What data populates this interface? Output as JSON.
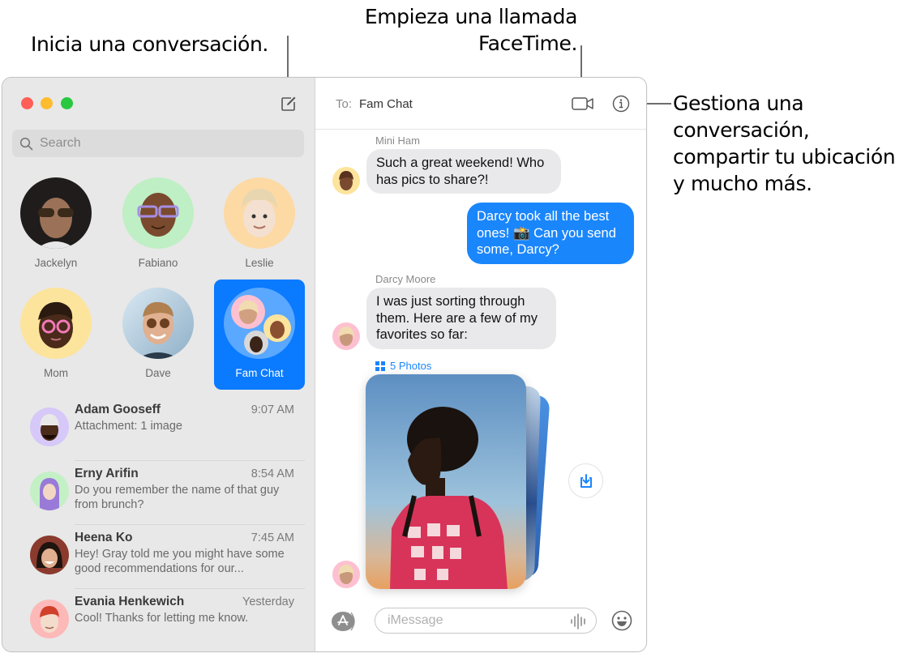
{
  "callouts": {
    "new_conversation": "Inicia una conversación.",
    "facetime_line1": "Empieza una llamada",
    "facetime_line2": "FaceTime.",
    "details_lines": [
      "Gestiona una",
      "conversación,",
      "compartir tu ubicación",
      "y mucho más."
    ]
  },
  "sidebar": {
    "search_placeholder": "Search",
    "pinned": [
      {
        "name": "Jackelyn",
        "bg": "#2a2a2a"
      },
      {
        "name": "Fabiano",
        "bg": "#bfefc4"
      },
      {
        "name": "Leslie",
        "bg": "#fdd9a4"
      },
      {
        "name": "Mom",
        "bg": "#fde49c"
      },
      {
        "name": "Dave",
        "bg": "#b8d3e6"
      },
      {
        "name": "Fam Chat",
        "bg": "#5aa8ff",
        "selected": true
      }
    ],
    "conversations": [
      {
        "name": "Adam Gooseff",
        "time": "9:07 AM",
        "preview": "Attachment: 1 image",
        "bg": "#d6c8f8"
      },
      {
        "name": "Erny Arifin",
        "time": "8:54 AM",
        "preview": "Do you remember the name of that guy from brunch?",
        "bg": "#c4f0c6"
      },
      {
        "name": "Heena Ko",
        "time": "7:45 AM",
        "preview": "Hey! Gray told me you might have some good recommendations for our...",
        "bg": "#8a3b2e"
      },
      {
        "name": "Evania Henkewich",
        "time": "Yesterday",
        "preview": "Cool! Thanks for letting me know.",
        "bg": "#fdb8b8"
      }
    ]
  },
  "chat": {
    "to_label": "To:",
    "to_value": "Fam Chat",
    "messages": [
      {
        "sender": "Mini Ham",
        "text": "Such a great weekend! Who has pics to share?!",
        "direction": "in"
      },
      {
        "sender": "",
        "text": "Darcy took all the best ones! 📸 Can you send some, Darcy?",
        "direction": "out"
      },
      {
        "sender": "Darcy Moore",
        "text": "I was just sorting through them. Here are a few of my favorites so far:",
        "direction": "in"
      }
    ],
    "photos_label": "5 Photos",
    "input_placeholder": "iMessage"
  },
  "colors": {
    "accent": "#0a7aff",
    "bubble_out": "#1a86fc",
    "bubble_in": "#e9e9eb"
  }
}
